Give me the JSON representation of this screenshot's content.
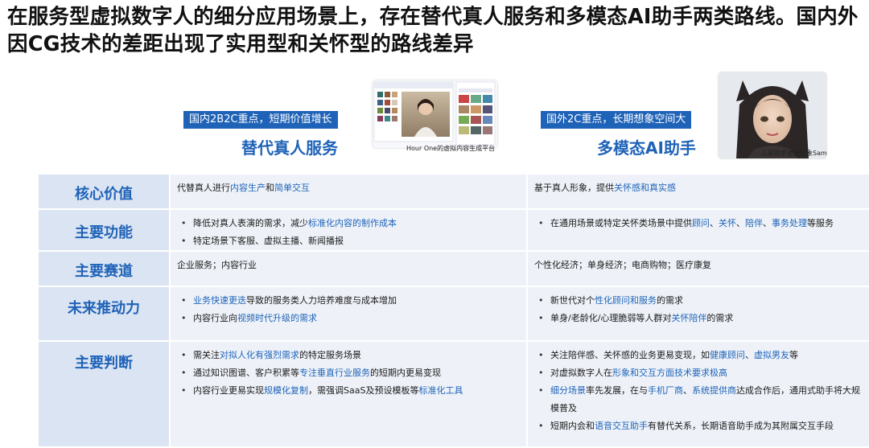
{
  "title": "在服务型虚拟数字人的细分应用场景上，存在替代真人服务和多模态AI助手两类路线。国内外因CG技术的差距出现了实用型和关怀型的路线差异",
  "left_header": {
    "badge": "国内2B2C重点，短期价值增长",
    "subtitle": "替代真人服务",
    "caption": "Hour One的虚拟内容生成平台"
  },
  "right_header": {
    "badge": "国外2C重点，长期想象空间大",
    "subtitle": "多模态AI助手",
    "caption": "三星助手虚拟形象Sam"
  },
  "rows": [
    {
      "header": "核心价值",
      "left": [
        {
          "type": "text",
          "parts": [
            {
              "t": "代替真人进行"
            },
            {
              "t": "内容生产",
              "hl": true
            },
            {
              "t": "和"
            },
            {
              "t": "简单交互",
              "hl": true
            }
          ]
        }
      ],
      "right": [
        {
          "type": "text",
          "parts": [
            {
              "t": "基于真人形象，提供"
            },
            {
              "t": "关怀感和真实感",
              "hl": true
            }
          ]
        }
      ]
    },
    {
      "header": "主要功能",
      "left": [
        {
          "type": "bullet",
          "parts": [
            {
              "t": "降低对真人表演的需求，减少"
            },
            {
              "t": "标准化内容的制作成本",
              "hl": true
            }
          ]
        },
        {
          "type": "bullet",
          "parts": [
            {
              "t": "特定场景下客服、虚拟主播、新闻播报"
            }
          ]
        }
      ],
      "right": [
        {
          "type": "bullet",
          "parts": [
            {
              "t": "在通用场景或特定关怀类场景中提供"
            },
            {
              "t": "顾问",
              "hl": true
            },
            {
              "t": "、"
            },
            {
              "t": "关怀",
              "hl": true
            },
            {
              "t": "、"
            },
            {
              "t": "陪伴",
              "hl": true
            },
            {
              "t": "、"
            },
            {
              "t": "事务处理",
              "hl": true
            },
            {
              "t": "等服务"
            }
          ]
        }
      ]
    },
    {
      "header": "主要赛道",
      "left": [
        {
          "type": "text",
          "parts": [
            {
              "t": "企业服务；内容行业"
            }
          ]
        }
      ],
      "right": [
        {
          "type": "text",
          "parts": [
            {
              "t": "个性化经济；单身经济；电商购物；医疗康复"
            }
          ]
        }
      ]
    },
    {
      "header": "未来推动力",
      "left": [
        {
          "type": "bullet",
          "parts": [
            {
              "t": "业务快速更迭",
              "hl": true
            },
            {
              "t": "导致的服务类人力培养难度与成本增加"
            }
          ]
        },
        {
          "type": "bullet",
          "parts": [
            {
              "t": "内容行业向"
            },
            {
              "t": "视频时代升级的需求",
              "hl": true
            }
          ]
        }
      ],
      "right": [
        {
          "type": "bullet",
          "parts": [
            {
              "t": "新世代对个"
            },
            {
              "t": "性化顾问和服务",
              "hl": true
            },
            {
              "t": "的需求"
            }
          ]
        },
        {
          "type": "bullet",
          "parts": [
            {
              "t": "单身/老龄化/心理脆弱等人群对"
            },
            {
              "t": "关怀陪伴",
              "hl": true
            },
            {
              "t": "的需求"
            }
          ]
        }
      ]
    },
    {
      "header": "主要判断",
      "left": [
        {
          "type": "bullet",
          "parts": [
            {
              "t": "需关注"
            },
            {
              "t": "对拟人化有强烈需求",
              "hl": true
            },
            {
              "t": "的特定服务场景"
            }
          ]
        },
        {
          "type": "bullet",
          "parts": [
            {
              "t": "通过知识图谱、客户积累等"
            },
            {
              "t": "专注垂直行业服务",
              "hl": true
            },
            {
              "t": "的短期内更易变现"
            }
          ]
        },
        {
          "type": "bullet",
          "parts": [
            {
              "t": "内容行业更易实现"
            },
            {
              "t": "规模化复制",
              "hl": true
            },
            {
              "t": "，需强调SaaS及预设模板等"
            },
            {
              "t": "标准化工具",
              "hl": true
            }
          ]
        }
      ],
      "right": [
        {
          "type": "bullet",
          "parts": [
            {
              "t": "关注陪伴感、关怀感的业务更易变现，如"
            },
            {
              "t": "健康顾问",
              "hl": true
            },
            {
              "t": "、"
            },
            {
              "t": "虚拟男友",
              "hl": true
            },
            {
              "t": "等"
            }
          ]
        },
        {
          "type": "bullet",
          "parts": [
            {
              "t": "对虚拟数字人在"
            },
            {
              "t": "形象和交互方面技术要求极高",
              "hl": true
            }
          ]
        },
        {
          "type": "bullet",
          "parts": [
            {
              "t": "细分场景",
              "hl": true
            },
            {
              "t": "率先发展，在与"
            },
            {
              "t": "手机厂商",
              "hl": true
            },
            {
              "t": "、"
            },
            {
              "t": "系统提供商",
              "hl": true
            },
            {
              "t": "达成合作后，通用式助手将大规模普及"
            }
          ]
        },
        {
          "type": "bullet",
          "parts": [
            {
              "t": "短期内会和"
            },
            {
              "t": "语音交互助手",
              "hl": true
            },
            {
              "t": "有替代关系，长期语音助手成为其附属交互手段"
            }
          ]
        }
      ]
    }
  ],
  "colors": {
    "accent": "#1f63b8",
    "header_cell": "#dbe4f2",
    "content_cell": "#eef2f8"
  },
  "icons": [
    "platform-screenshot",
    "avatar-sam-image"
  ]
}
